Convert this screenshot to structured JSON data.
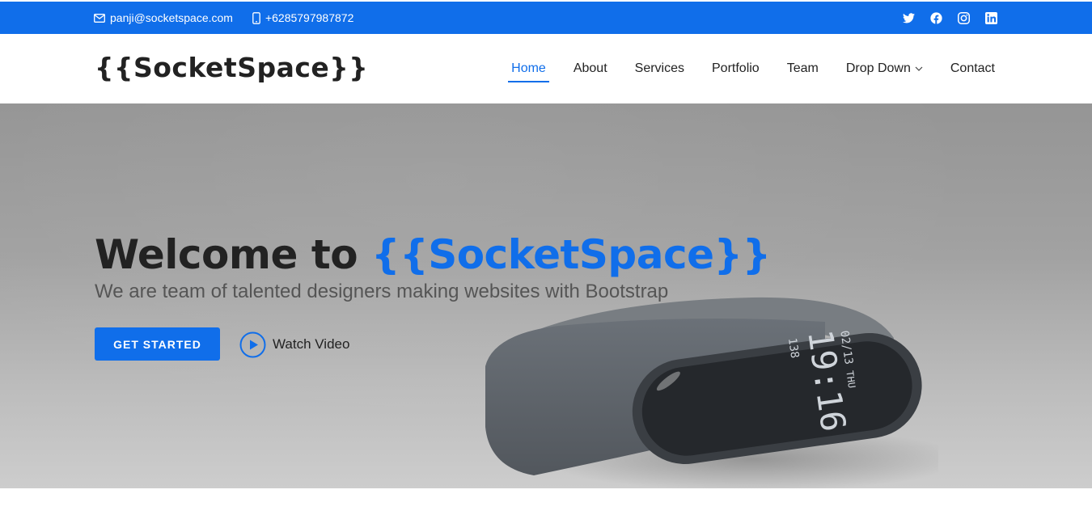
{
  "topbar": {
    "email": "panji@socketspace.com",
    "phone": "+6285797987872",
    "social_icons": [
      "twitter-icon",
      "facebook-icon",
      "instagram-icon",
      "linkedin-icon"
    ],
    "color": "#106eea"
  },
  "header": {
    "logo": "{{SocketSpace}}",
    "nav": [
      {
        "label": "Home",
        "active": true
      },
      {
        "label": "About"
      },
      {
        "label": "Services"
      },
      {
        "label": "Portfolio"
      },
      {
        "label": "Team"
      },
      {
        "label": "Drop Down",
        "has_dropdown": true
      },
      {
        "label": "Contact"
      }
    ]
  },
  "hero": {
    "title_prefix": "Welcome to ",
    "title_brand": "{{SocketSpace}}",
    "subtitle": "We are team of talented designers making websites with Bootstrap",
    "cta_label": "GET STARTED",
    "video_label": "Watch Video",
    "watch_time": "19:16",
    "watch_date": "02/13",
    "watch_day": "THU",
    "watch_steps": "138"
  },
  "colors": {
    "accent": "#106eea",
    "text": "#222222"
  }
}
